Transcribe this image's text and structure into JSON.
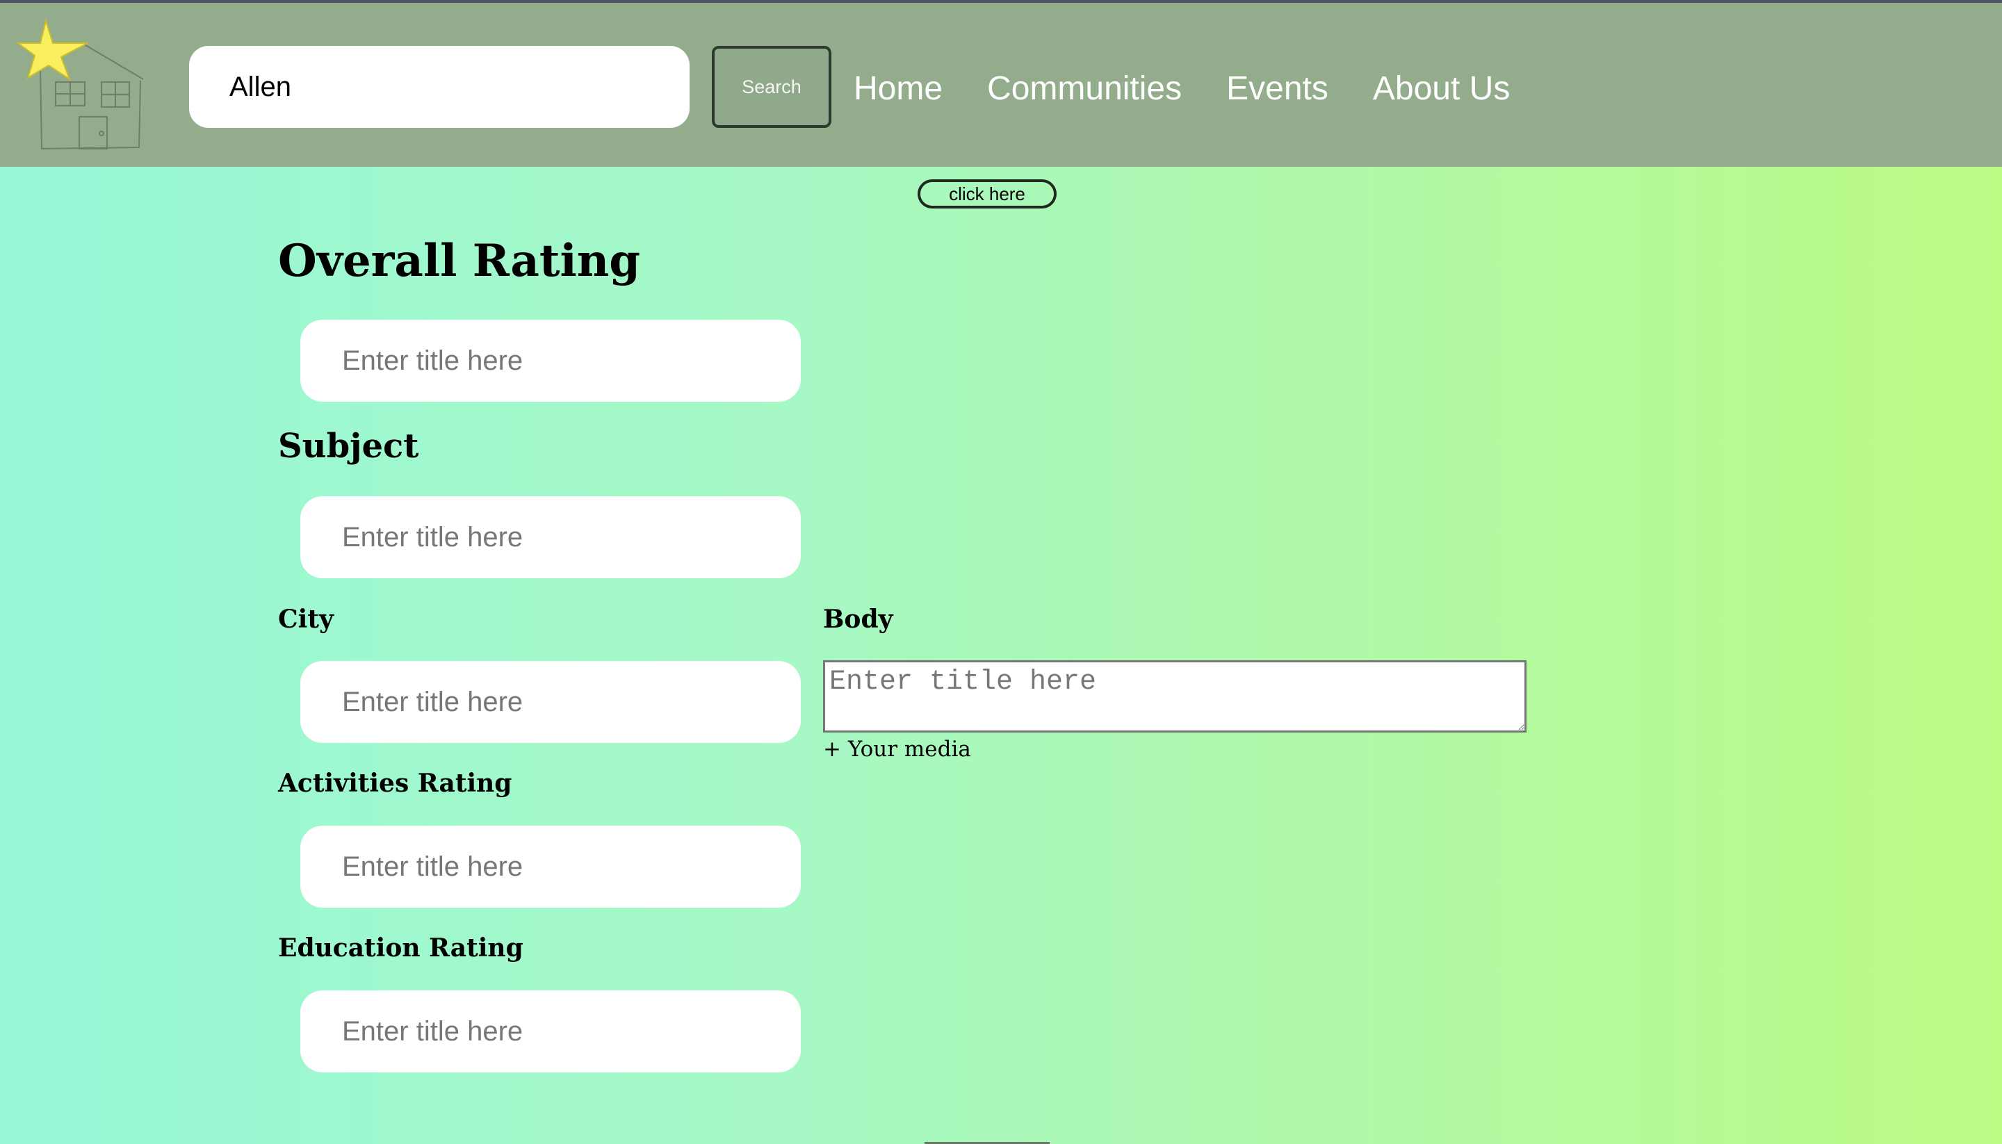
{
  "header": {
    "search": {
      "value": "Allen",
      "button_label": "Search"
    },
    "nav": [
      "Home",
      "Communities",
      "Events",
      "About Us"
    ]
  },
  "click_button_label": "click here",
  "form": {
    "overall_rating": {
      "label": "Overall Rating",
      "placeholder": "Enter title here"
    },
    "subject": {
      "label": "Subject",
      "placeholder": "Enter title here"
    },
    "city": {
      "label": "City",
      "placeholder": "Enter title here"
    },
    "activities_rating": {
      "label": "Activities Rating",
      "placeholder": "Enter title here"
    },
    "education_rating": {
      "label": "Education Rating",
      "placeholder": "Enter title here"
    },
    "body": {
      "label": "Body",
      "placeholder": "Enter title here",
      "media_link": "+ Your media"
    }
  },
  "colors": {
    "header_bg": "#93ad8c",
    "gradient_start": "#98f8d8",
    "gradient_end": "#bcfb84",
    "star": "#f8ee5e"
  },
  "icons": {
    "logo": "house-with-star-icon"
  }
}
